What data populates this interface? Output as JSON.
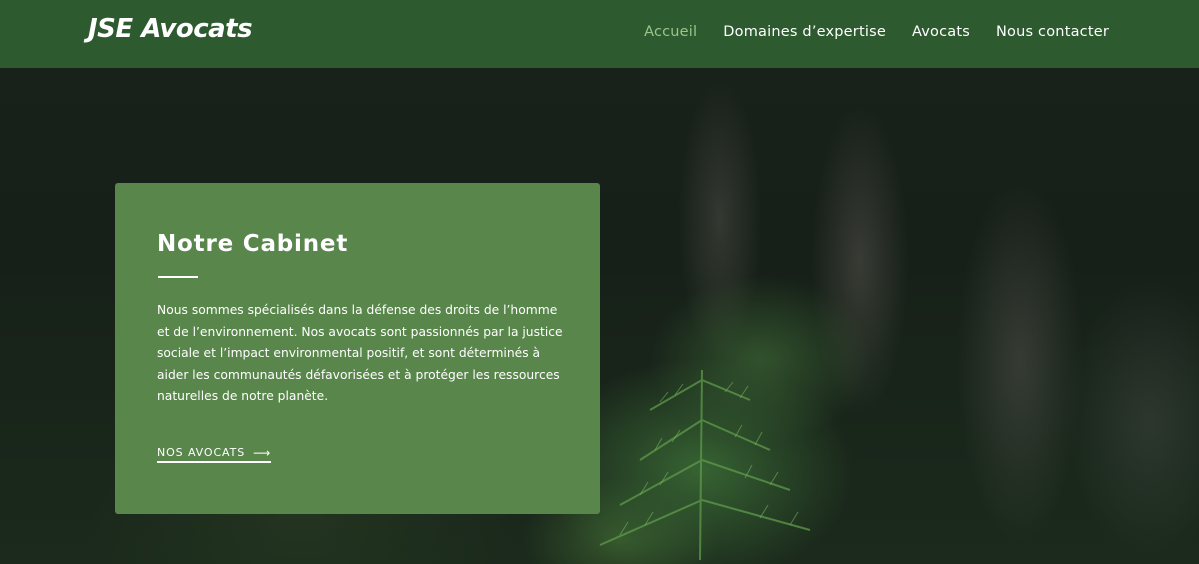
{
  "header": {
    "logo": "JSE Avocats",
    "nav": [
      {
        "label": "Accueil",
        "active": true
      },
      {
        "label": "Domaines d’expertise",
        "active": false
      },
      {
        "label": "Avocats",
        "active": false
      },
      {
        "label": "Nous contacter",
        "active": false
      }
    ]
  },
  "hero": {
    "card": {
      "title": "Notre Cabinet",
      "text": "Nous sommes spécialisés dans la défense des droits de l’homme et de l’environnement. Nos avocats sont passionnés par la justice sociale et l’impact environmental positif, et sont déterminés à aider les communautés défavorisées et à protéger les ressources naturelles de notre planète.",
      "link_label": "NOS AVOCATS",
      "link_icon": "arrow-right-icon"
    }
  },
  "colors": {
    "navbar": "#2e5a30",
    "card": "#58864b",
    "nav_active": "#9cc48a",
    "text": "#ffffff"
  }
}
